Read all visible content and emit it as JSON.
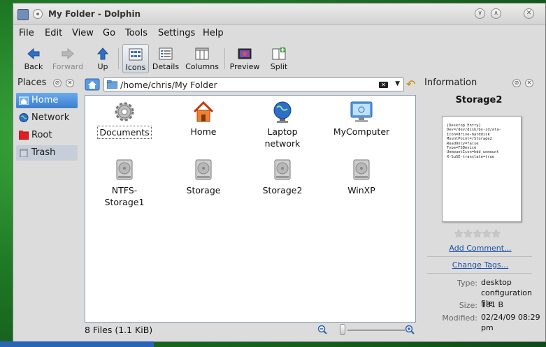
{
  "window": {
    "title": "My Folder - Dolphin"
  },
  "menubar": [
    {
      "label": "File"
    },
    {
      "label": "Edit"
    },
    {
      "label": "View"
    },
    {
      "label": "Go"
    },
    {
      "label": "Tools"
    },
    {
      "label": "Settings"
    },
    {
      "label": "Help"
    }
  ],
  "toolbar": {
    "back": "Back",
    "forward": "Forward",
    "up": "Up",
    "icons": "Icons",
    "details": "Details",
    "columns": "Columns",
    "preview": "Preview",
    "split": "Split"
  },
  "places": {
    "title": "Places",
    "items": [
      {
        "label": "Home",
        "icon": "home-icon"
      },
      {
        "label": "Network",
        "icon": "network-icon"
      },
      {
        "label": "Root",
        "icon": "root-folder-icon"
      },
      {
        "label": "Trash",
        "icon": "trash-icon"
      }
    ]
  },
  "location": {
    "path": "/home/chris/My Folder"
  },
  "files": [
    {
      "label": "Documents",
      "icon": "gear-icon"
    },
    {
      "label": "Home",
      "icon": "home-icon"
    },
    {
      "label": "Laptop network",
      "icon": "globe-icon"
    },
    {
      "label": "MyComputer",
      "icon": "monitor-icon"
    },
    {
      "label": "NTFS-Storage1",
      "icon": "harddisk-icon"
    },
    {
      "label": "Storage",
      "icon": "harddisk-icon"
    },
    {
      "label": "Storage2",
      "icon": "harddisk-icon"
    },
    {
      "label": "WinXP",
      "icon": "harddisk-icon"
    }
  ],
  "status": {
    "text": "8 Files (1.1 KiB)"
  },
  "info": {
    "title": "Information",
    "name": "Storage2",
    "preview_text": "[Desktop Entry]\nDev=/dev/disk/by-id/ata-\nIcon=drive-harddisk\nMountPoint=/Storage2\nReadOnly=false\nType=FSDevice\nUnmountIcon=hdd_unmount\nX-SuSE-translate=true",
    "rating": 0,
    "add_comment": "Add Comment...",
    "change_tags": "Change Tags...",
    "type_key": "Type:",
    "type_value": "desktop configuration file",
    "size_key": "Size:",
    "size_value": "181 B",
    "modified_key": "Modified:",
    "modified_value": "02/24/09 08:29 pm"
  },
  "colors": {
    "selection": "#3a7fcf",
    "link": "#1a4fa8"
  }
}
